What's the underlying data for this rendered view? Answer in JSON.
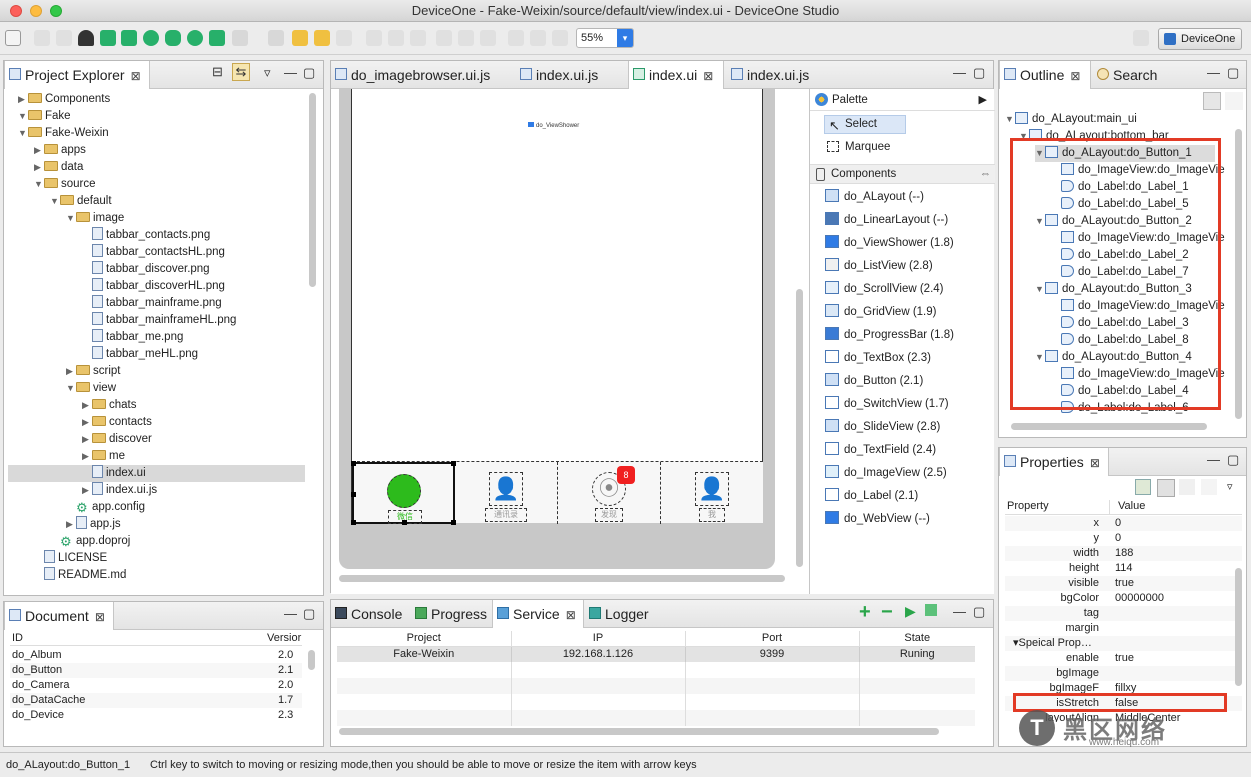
{
  "window": {
    "title": "DeviceOne - Fake-Weixin/source/default/view/index.ui - DeviceOne Studio",
    "zoom": "55%",
    "brand": "DeviceOne"
  },
  "project_explorer": {
    "tab": "Project Explorer",
    "items": [
      {
        "label": "Components",
        "depth": 0,
        "type": "project"
      },
      {
        "label": "Fake",
        "depth": 0,
        "type": "project"
      },
      {
        "label": "Fake-Weixin",
        "depth": 1,
        "type": "project"
      },
      {
        "label": "apps",
        "depth": 2,
        "type": "folder"
      },
      {
        "label": "data",
        "depth": 2,
        "type": "folder"
      },
      {
        "label": "source",
        "depth": 2,
        "type": "folder"
      },
      {
        "label": "default",
        "depth": 3,
        "type": "folder"
      },
      {
        "label": "image",
        "depth": 4,
        "type": "folder"
      },
      {
        "label": "tabbar_contacts.png",
        "depth": 5,
        "type": "file"
      },
      {
        "label": "tabbar_contactsHL.png",
        "depth": 5,
        "type": "file"
      },
      {
        "label": "tabbar_discover.png",
        "depth": 5,
        "type": "file"
      },
      {
        "label": "tabbar_discoverHL.png",
        "depth": 5,
        "type": "file"
      },
      {
        "label": "tabbar_mainframe.png",
        "depth": 5,
        "type": "file"
      },
      {
        "label": "tabbar_mainframeHL.png",
        "depth": 5,
        "type": "file"
      },
      {
        "label": "tabbar_me.png",
        "depth": 5,
        "type": "file"
      },
      {
        "label": "tabbar_meHL.png",
        "depth": 5,
        "type": "file"
      },
      {
        "label": "script",
        "depth": 4,
        "type": "folder"
      },
      {
        "label": "view",
        "depth": 4,
        "type": "folder"
      },
      {
        "label": "chats",
        "depth": 5,
        "type": "folder"
      },
      {
        "label": "contacts",
        "depth": 5,
        "type": "folder"
      },
      {
        "label": "discover",
        "depth": 5,
        "type": "folder"
      },
      {
        "label": "me",
        "depth": 5,
        "type": "folder"
      },
      {
        "label": "index.ui",
        "depth": 5,
        "type": "file"
      },
      {
        "label": "index.ui.js",
        "depth": 5,
        "type": "file"
      },
      {
        "label": "app.config",
        "depth": 4,
        "type": "gear"
      },
      {
        "label": "app.js",
        "depth": 4,
        "type": "file"
      },
      {
        "label": "app.doproj",
        "depth": 2,
        "type": "gear"
      },
      {
        "label": "LICENSE",
        "depth": 2,
        "type": "file"
      },
      {
        "label": "README.md",
        "depth": 2,
        "type": "file"
      }
    ]
  },
  "document": {
    "tab": "Document",
    "col_id": "ID",
    "col_version": "Versior",
    "rows": [
      {
        "id": "do_Album",
        "v": "2.0"
      },
      {
        "id": "do_Button",
        "v": "2.1"
      },
      {
        "id": "do_Camera",
        "v": "2.0"
      },
      {
        "id": "do_DataCache",
        "v": "1.7"
      },
      {
        "id": "do_Device",
        "v": "2.3"
      }
    ]
  },
  "editor": {
    "tabs": [
      "do_imagebrowser.ui.js",
      "index.ui.js",
      "index.ui",
      "index.ui.js"
    ],
    "viewshower": "do_ViewShower",
    "tabbar": {
      "labels": [
        "微信",
        "通讯录",
        "发现",
        "我"
      ],
      "badge": "8"
    }
  },
  "palette": {
    "title": "Palette",
    "select": "Select",
    "marquee": "Marquee",
    "components_title": "Components",
    "items": [
      "do_ALayout (--)",
      "do_LinearLayout (--)",
      "do_ViewShower (1.8)",
      "do_ListView (2.8)",
      "do_ScrollView (2.4)",
      "do_GridView (1.9)",
      "do_ProgressBar (1.8)",
      "do_TextBox (2.3)",
      "do_Button (2.1)",
      "do_SwitchView (1.7)",
      "do_SlideView (2.8)",
      "do_TextField (2.4)",
      "do_ImageView (2.5)",
      "do_Label (2.1)",
      "do_WebView (--)"
    ]
  },
  "console": {
    "tabs": [
      "Console",
      "Progress",
      "Service",
      "Logger"
    ],
    "headers": [
      "Project",
      "IP",
      "Port",
      "State"
    ],
    "row": {
      "project": "Fake-Weixin",
      "ip": "192.168.1.126",
      "port": "9399",
      "state": "Runing"
    }
  },
  "outline": {
    "tab": "Outline",
    "search": "Search",
    "items": [
      {
        "label": "do_ALayout:main_ui",
        "depth": 0
      },
      {
        "label": "do_ALayout:bottom_bar",
        "depth": 1
      },
      {
        "label": "do_ALayout:do_Button_1",
        "depth": 2
      },
      {
        "label": "do_ImageView:do_ImageVie",
        "depth": 3
      },
      {
        "label": "do_Label:do_Label_1",
        "depth": 3
      },
      {
        "label": "do_Label:do_Label_5",
        "depth": 3
      },
      {
        "label": "do_ALayout:do_Button_2",
        "depth": 2
      },
      {
        "label": "do_ImageView:do_ImageVie",
        "depth": 3
      },
      {
        "label": "do_Label:do_Label_2",
        "depth": 3
      },
      {
        "label": "do_Label:do_Label_7",
        "depth": 3
      },
      {
        "label": "do_ALayout:do_Button_3",
        "depth": 2
      },
      {
        "label": "do_ImageView:do_ImageVie",
        "depth": 3
      },
      {
        "label": "do_Label:do_Label_3",
        "depth": 3
      },
      {
        "label": "do_Label:do_Label_8",
        "depth": 3
      },
      {
        "label": "do_ALayout:do_Button_4",
        "depth": 2
      },
      {
        "label": "do_ImageView:do_ImageVie",
        "depth": 3
      },
      {
        "label": "do_Label:do_Label_4",
        "depth": 3
      },
      {
        "label": "do_Label:do_Label_6",
        "depth": 3
      }
    ]
  },
  "properties": {
    "tab": "Properties",
    "col_property": "Property",
    "col_value": "Value",
    "rows": [
      {
        "k": "x",
        "v": "0"
      },
      {
        "k": "y",
        "v": "0"
      },
      {
        "k": "width",
        "v": "188"
      },
      {
        "k": "height",
        "v": "114"
      },
      {
        "k": "visible",
        "v": "true"
      },
      {
        "k": "bgColor",
        "v": "00000000"
      },
      {
        "k": "tag",
        "v": ""
      },
      {
        "k": "margin",
        "v": ""
      },
      {
        "k": "▾Speical Prop…",
        "v": ""
      },
      {
        "k": "enable",
        "v": "true"
      },
      {
        "k": "bgImage",
        "v": ""
      },
      {
        "k": "bgImageF",
        "v": "fillxy"
      },
      {
        "k": "isStretch",
        "v": "false"
      },
      {
        "k": "layoutAlign",
        "v": "MiddleCenter"
      }
    ]
  },
  "status": {
    "selection": "do_ALayout:do_Button_1",
    "hint": "Ctrl key to switch to moving or resizing mode,then you should be able to move or resize the item with arrow keys"
  },
  "watermark": {
    "text": "黑区网络",
    "url": "www.heiqu.com"
  }
}
